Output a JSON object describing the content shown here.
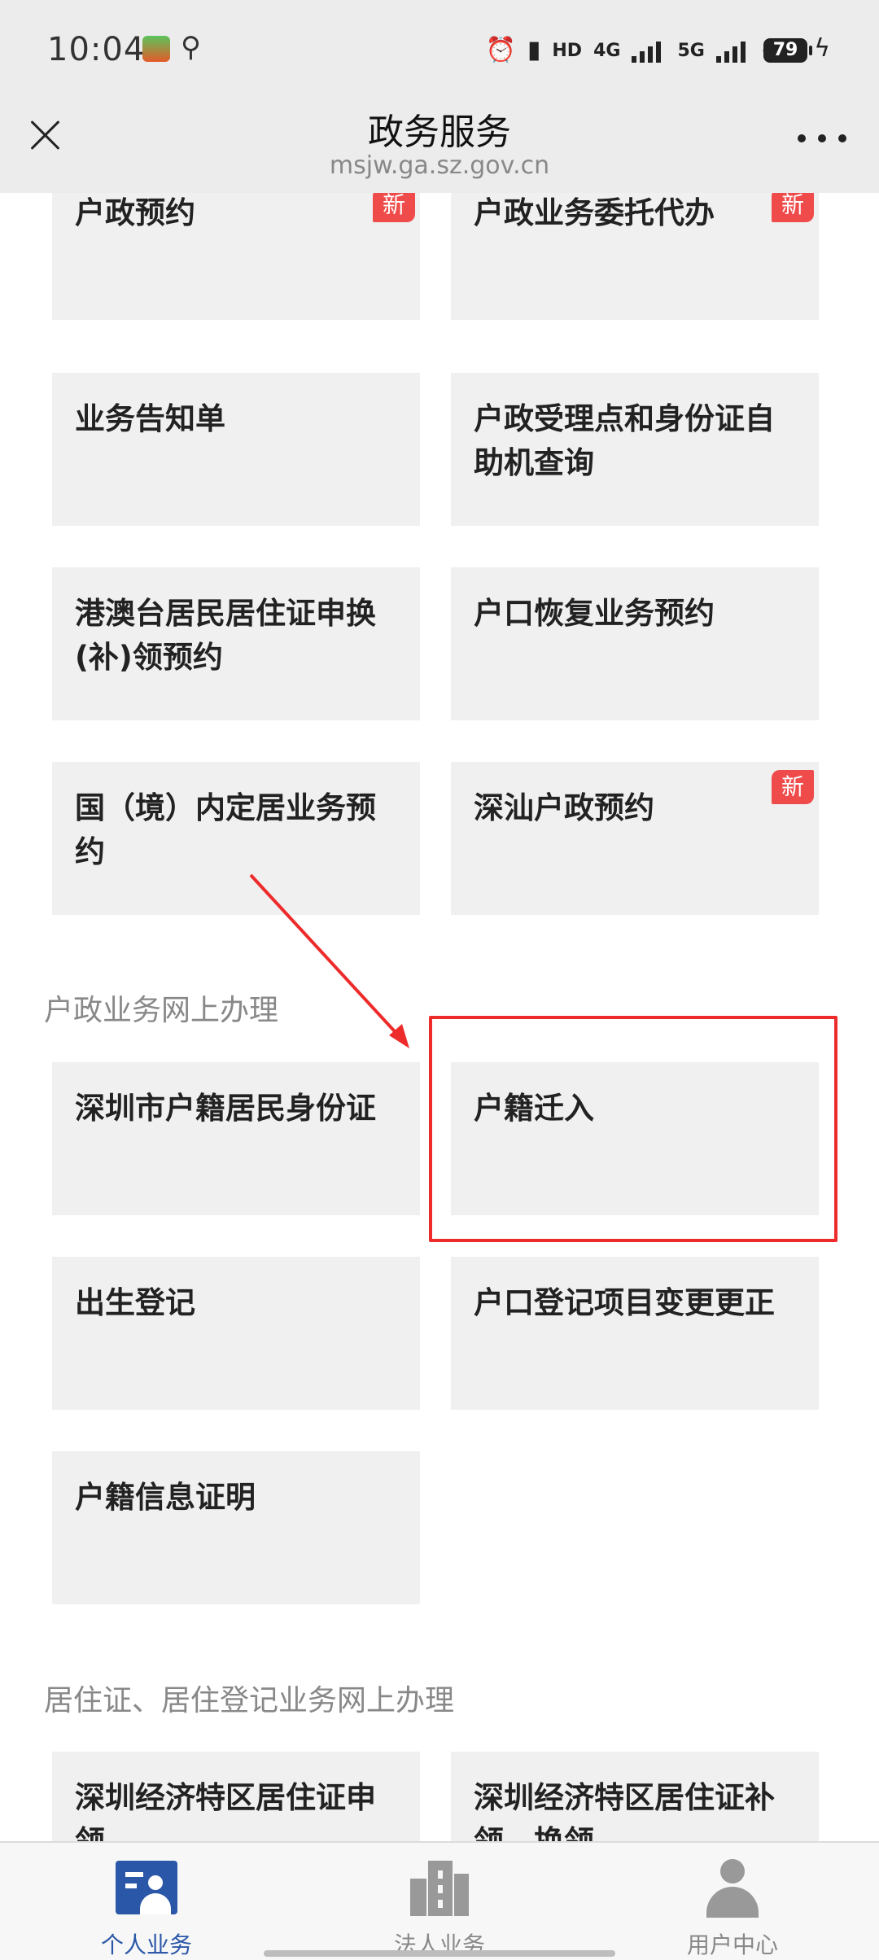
{
  "status_bar": {
    "time": "10:04",
    "hd_label": "HD",
    "net1": "4G",
    "net2": "5G",
    "battery": "79"
  },
  "header": {
    "title": "政务服务",
    "url": "msjw.ga.sz.gov.cn"
  },
  "badge_new": "新",
  "appointment_tiles": [
    {
      "label": "户政预约",
      "new": true
    },
    {
      "label": "户政业务委托代办",
      "new": true
    },
    {
      "label": "业务告知单",
      "new": false
    },
    {
      "label": "户政受理点和身份证自助机查询",
      "new": false
    },
    {
      "label": "港澳台居民居住证申换(补)领预约",
      "new": false
    },
    {
      "label": "户口恢复业务预约",
      "new": false
    },
    {
      "label": "国（境）内定居业务预约",
      "new": false
    },
    {
      "label": "深汕户政预约",
      "new": true
    }
  ],
  "section_household": {
    "title": "户政业务网上办理",
    "tiles": [
      "深圳市户籍居民身份证",
      "户籍迁入",
      "出生登记",
      "户口登记项目变更更正",
      "户籍信息证明"
    ]
  },
  "section_residence": {
    "title": "居住证、居住登记业务网上办理",
    "tiles": [
      "深圳经济特区居住证申领",
      "深圳经济特区居住证补领、换领"
    ]
  },
  "bottom_nav": [
    {
      "label": "个人业务",
      "icon": "personal-icon",
      "active": true
    },
    {
      "label": "法人业务",
      "icon": "building-icon",
      "active": false
    },
    {
      "label": "用户中心",
      "icon": "user-icon",
      "active": false
    }
  ],
  "colors": {
    "accent": "#2a57a8",
    "badge": "#f04b4b",
    "annotation": "#ee2b2b"
  }
}
